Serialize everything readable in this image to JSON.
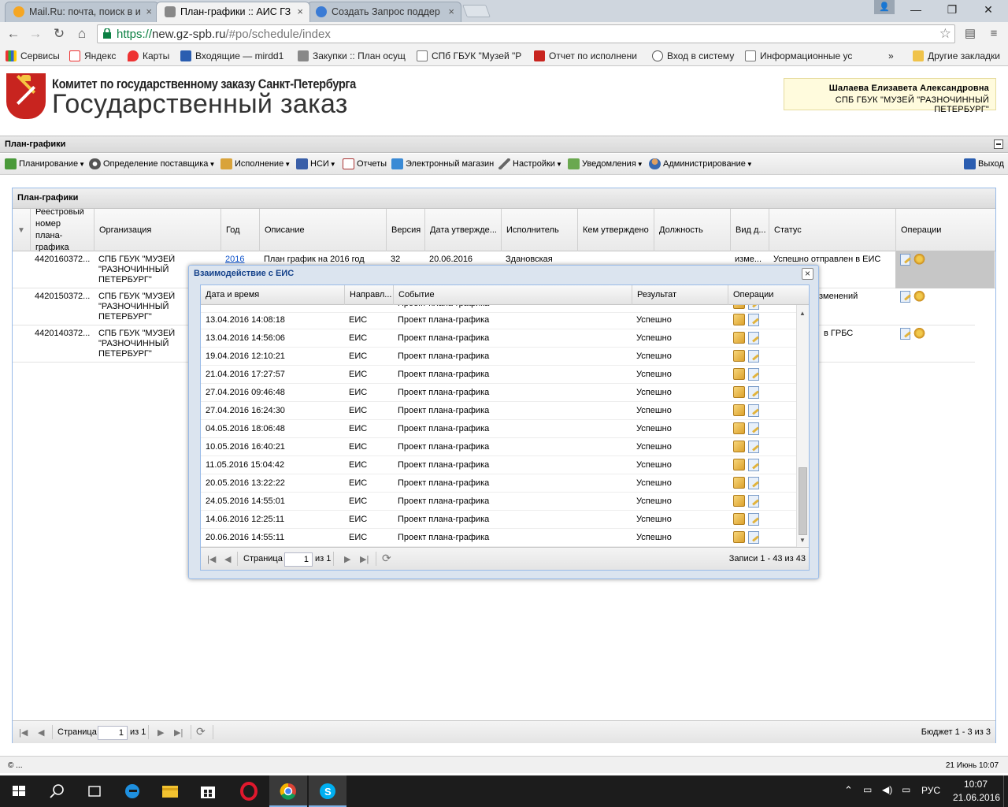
{
  "browser": {
    "tabs": [
      {
        "title": "Mail.Ru: почта, поиск в и"
      },
      {
        "title": "План-графики :: АИС ГЗ"
      },
      {
        "title": "Создать Запрос поддер"
      }
    ],
    "url_scheme": "https://",
    "url_host": "new.gz-spb.ru",
    "url_path": "/#po/schedule/index",
    "bookmarks": [
      "Сервисы",
      "Яндекс",
      "Карты",
      "Входящие — mirdd1",
      "Закупки :: План осущ",
      "СПб ГБУК \"Музей \"Р",
      "Отчет по исполнени",
      "Вход в систему",
      "Информационные ус"
    ],
    "bookmarks_more": "»",
    "other_bookmarks": "Другие закладки"
  },
  "header": {
    "line1": "Комитет по государственному заказу Санкт-Петербурга",
    "line2": "Государственный заказ",
    "user_name": "Шалаева Елизавета Александровна",
    "user_org": "СПБ ГБУК \"МУЗЕЙ \"РАЗНОЧИННЫЙ ПЕТЕРБУРГ\""
  },
  "panel_title": "План-графики",
  "menu": [
    {
      "label": "Планирование",
      "dropdown": true,
      "icon": "planning-icon"
    },
    {
      "label": "Определение поставщика",
      "dropdown": true,
      "icon": "gears-icon"
    },
    {
      "label": "Исполнение",
      "dropdown": true,
      "icon": "execution-icon"
    },
    {
      "label": "НСИ",
      "dropdown": true,
      "icon": "book-icon"
    },
    {
      "label": "Отчеты",
      "dropdown": false,
      "icon": "report-icon"
    },
    {
      "label": "Электронный магазин",
      "dropdown": false,
      "icon": "cart-icon"
    },
    {
      "label": "Настройки",
      "dropdown": true,
      "icon": "wrench-icon"
    },
    {
      "label": "Уведомления",
      "dropdown": true,
      "icon": "notification-icon"
    },
    {
      "label": "Администрирование",
      "dropdown": true,
      "icon": "user-icon"
    }
  ],
  "logout": "Выход",
  "grid": {
    "title": "План-графики",
    "columns": [
      "Реестровый номер плана-графика",
      "Организация",
      "Год",
      "Описание",
      "Версия",
      "Дата утвержде...",
      "Исполнитель",
      "Кем утверждено",
      "Должность",
      "Вид д...",
      "Статус",
      "Операции"
    ],
    "rows": [
      {
        "reg": "4420160372...",
        "org": "СПБ ГБУК \"МУЗЕЙ \"РАЗНОЧИННЫЙ ПЕТЕРБУРГ\"",
        "year": "2016",
        "desc": "План график на 2016 год",
        "ver": "32",
        "date": "20.06.2016",
        "exec": "Здановская",
        "kind": "изме...",
        "status": "Успешно отправлен в ЕИС"
      },
      {
        "reg": "4420150372...",
        "org": "СПБ ГБУК \"МУЗЕЙ \"РАЗНОЧИННЫЙ ПЕТЕРБУРГ\"",
        "status_tail": "зменений"
      },
      {
        "reg": "4420140372...",
        "org": "СПБ ГБУК \"МУЗЕЙ \"РАЗНОЧИННЫЙ ПЕТЕРБУРГ\"",
        "status_tail": "в ГРБС"
      }
    ],
    "pager": {
      "page_label": "Страница",
      "page": "1",
      "of": "из 1",
      "summary": "Бюджет 1 - 3 из 3"
    }
  },
  "dialog": {
    "title": "Взаимодействие с ЕИС",
    "columns": [
      "Дата и время",
      "Направл...",
      "Событие",
      "Результат",
      "Операции"
    ],
    "rows": [
      {
        "dt": "13.04.2016 14:08:18",
        "dir": "ЕИС",
        "event": "Проект плана-графика",
        "result": "Успешно"
      },
      {
        "dt": "13.04.2016 14:56:06",
        "dir": "ЕИС",
        "event": "Проект плана-графика",
        "result": "Успешно"
      },
      {
        "dt": "19.04.2016 12:10:21",
        "dir": "ЕИС",
        "event": "Проект плана-графика",
        "result": "Успешно"
      },
      {
        "dt": "21.04.2016 17:27:57",
        "dir": "ЕИС",
        "event": "Проект плана-графика",
        "result": "Успешно"
      },
      {
        "dt": "27.04.2016 09:46:48",
        "dir": "ЕИС",
        "event": "Проект плана-графика",
        "result": "Успешно"
      },
      {
        "dt": "27.04.2016 16:24:30",
        "dir": "ЕИС",
        "event": "Проект плана-графика",
        "result": "Успешно"
      },
      {
        "dt": "04.05.2016 18:06:48",
        "dir": "ЕИС",
        "event": "Проект плана-графика",
        "result": "Успешно"
      },
      {
        "dt": "10.05.2016 16:40:21",
        "dir": "ЕИС",
        "event": "Проект плана-графика",
        "result": "Успешно"
      },
      {
        "dt": "11.05.2016 15:04:42",
        "dir": "ЕИС",
        "event": "Проект плана-графика",
        "result": "Успешно"
      },
      {
        "dt": "20.05.2016 13:22:22",
        "dir": "ЕИС",
        "event": "Проект плана-графика",
        "result": "Успешно"
      },
      {
        "dt": "24.05.2016 14:55:01",
        "dir": "ЕИС",
        "event": "Проект плана-графика",
        "result": "Успешно"
      },
      {
        "dt": "14.06.2016 12:25:11",
        "dir": "ЕИС",
        "event": "Проект плана-графика",
        "result": "Успешно"
      },
      {
        "dt": "20.06.2016 14:55:11",
        "dir": "ЕИС",
        "event": "Проект плана-графика",
        "result": "Успешно"
      }
    ],
    "partial_row_event": "Проект плана-графика",
    "pager": {
      "page_label": "Страница",
      "page": "1",
      "of": "из 1",
      "summary": "Записи 1 - 43 из 43"
    }
  },
  "footer": {
    "copyright": "© ...",
    "datetime": "21 Июнь 10:07"
  },
  "taskbar": {
    "lang": "РУС",
    "time": "10:07",
    "date": "21.06.2016"
  },
  "colors": {
    "accent": "#99bbe8",
    "url_green": "#0b8043",
    "logo_red": "#c8241f"
  }
}
